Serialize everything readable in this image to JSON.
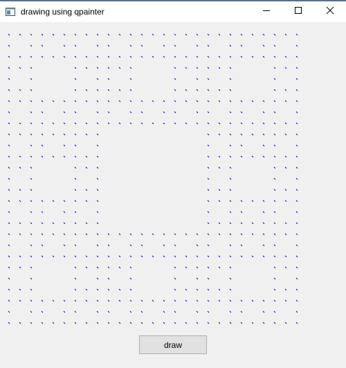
{
  "window": {
    "title": "drawing using qpainter"
  },
  "titlebar_buttons": {
    "minimize_icon": "minimize-icon",
    "maximize_icon": "maximize-icon",
    "close_icon": "close-icon"
  },
  "canvas": {
    "pattern": "sierpinski-carpet",
    "mark_color": "#0000cc",
    "grid_size": 27
  },
  "draw_button": {
    "label": "draw"
  },
  "colors": {
    "background": "#f0f0f0",
    "titlebar": "#ffffff",
    "accent": "#5a6f88"
  }
}
